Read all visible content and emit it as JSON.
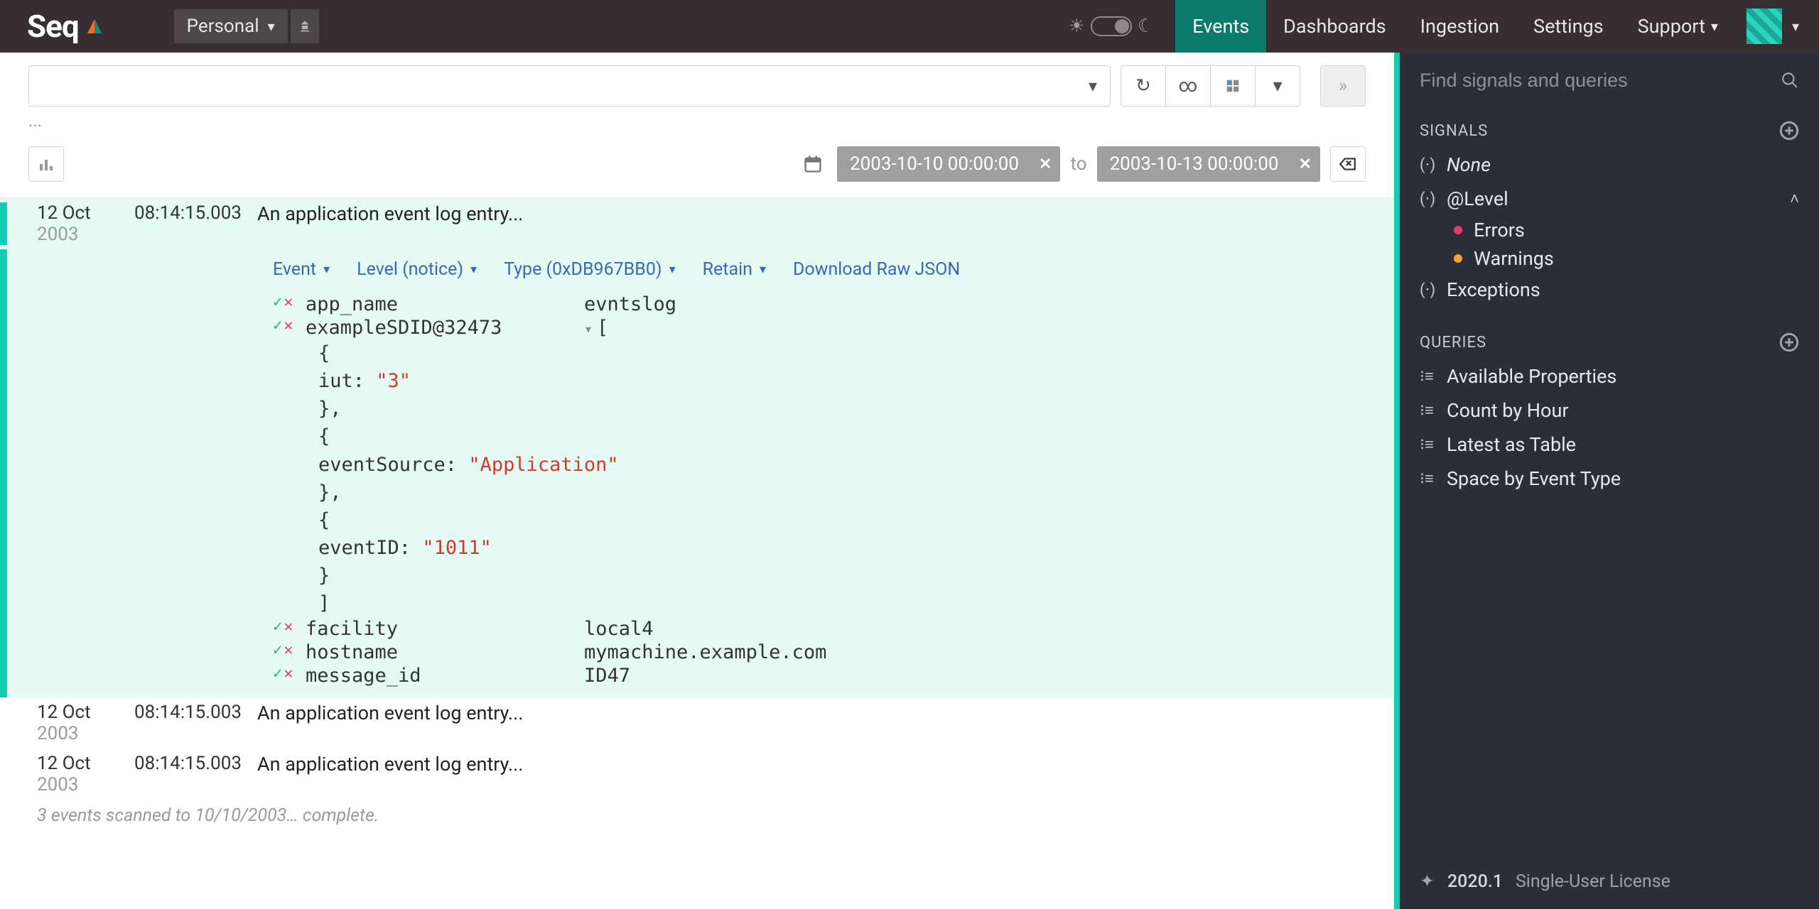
{
  "brand": "Seq",
  "workspace": {
    "name": "Personal"
  },
  "nav": {
    "events": "Events",
    "dashboards": "Dashboards",
    "ingestion": "Ingestion",
    "settings": "Settings",
    "support": "Support"
  },
  "search": {
    "ellipsis": "...",
    "date_from": "2003-10-10 00:00:00",
    "date_to_label": "to",
    "date_to": "2003-10-13 00:00:00"
  },
  "expanded_event": {
    "date_day": "12 Oct",
    "date_year": "2003",
    "time": "08:14:15.003",
    "message": "An application event log entry...",
    "actions": {
      "event": "Event",
      "level": "Level (notice)",
      "type": "Type (0xDB967BB0)",
      "retain": "Retain",
      "download": "Download Raw JSON"
    },
    "props": {
      "app_name": {
        "key": "app_name",
        "value": "evntslog"
      },
      "sd": {
        "key": "exampleSDID@32473",
        "json_lines": [
          "[",
          "{",
          "  iut: \"3\"",
          "},",
          "{",
          "  eventSource: \"Application\"",
          "},",
          "{",
          "  eventID: \"1011\"",
          "}",
          "]"
        ]
      },
      "facility": {
        "key": "facility",
        "value": "local4"
      },
      "hostname": {
        "key": "hostname",
        "value": "mymachine.example.com"
      },
      "message_id": {
        "key": "message_id",
        "value": "ID47"
      }
    }
  },
  "other_events": [
    {
      "date_day": "12 Oct",
      "date_year": "2003",
      "time": "08:14:15.003",
      "message": "An application event log entry..."
    },
    {
      "date_day": "12 Oct",
      "date_year": "2003",
      "time": "08:14:15.003",
      "message": "An application event log entry..."
    }
  ],
  "scan_status": "3 events scanned to 10/10/2003… complete.",
  "sidebar": {
    "search_placeholder": "Find signals and queries",
    "signals_header": "SIGNALS",
    "signals": {
      "none": "None",
      "level": "@Level",
      "errors": "Errors",
      "warnings": "Warnings",
      "exceptions": "Exceptions"
    },
    "queries_header": "QUERIES",
    "queries": {
      "q0": "Available Properties",
      "q1": "Count by Hour",
      "q2": "Latest as Table",
      "q3": "Space by Event Type"
    }
  },
  "footer": {
    "version": "2020.1",
    "license": "Single-User License"
  }
}
